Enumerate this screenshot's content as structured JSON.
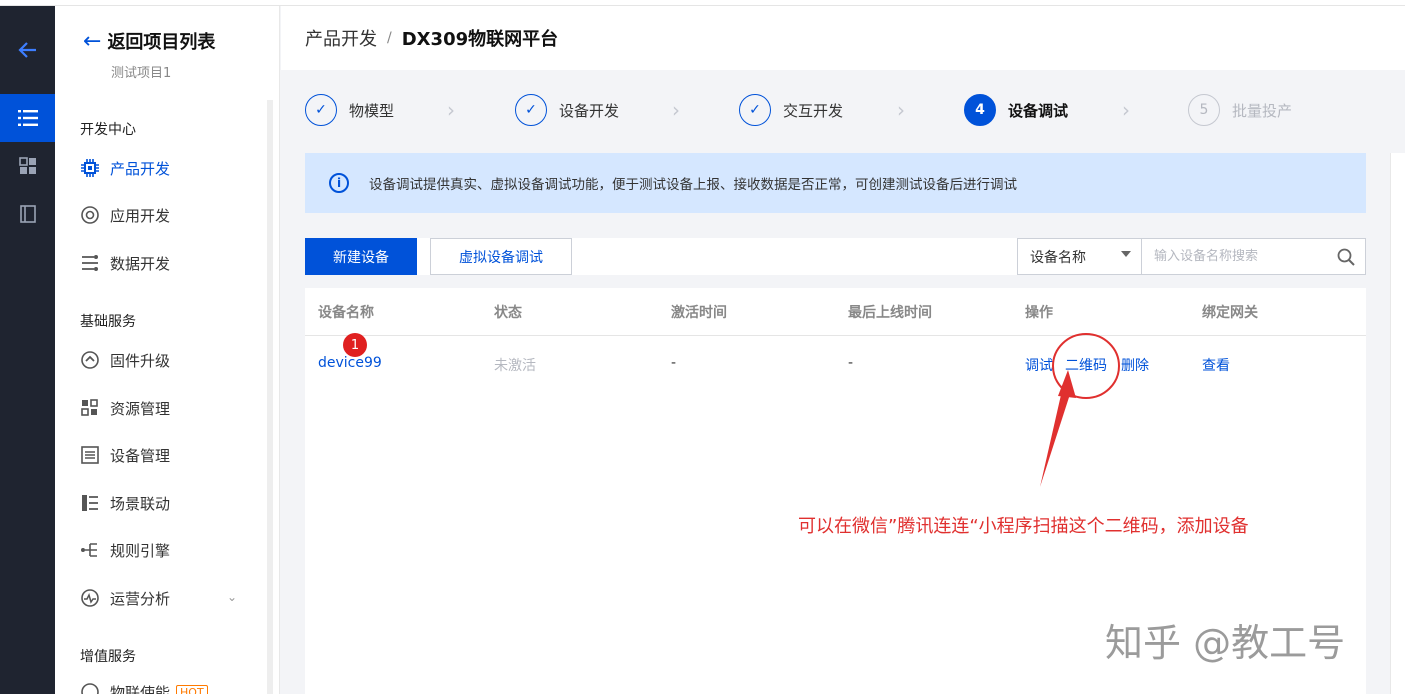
{
  "header": {
    "crumb_parent": "产品开发",
    "sep": "/",
    "crumb_current": "DX309物联网平台"
  },
  "sidebar": {
    "back_label": "返回项目列表",
    "project_name": "测试项目1",
    "sections": [
      {
        "title": "开发中心",
        "items": [
          "产品开发",
          "应用开发",
          "数据开发"
        ]
      },
      {
        "title": "基础服务",
        "items": [
          "固件升级",
          "资源管理",
          "设备管理",
          "场景联动",
          "规则引擎",
          "运营分析"
        ]
      },
      {
        "title": "增值服务",
        "items": [
          "物联使能"
        ]
      }
    ],
    "hot_badge": "HOT",
    "active_item": "产品开发"
  },
  "steps": [
    {
      "num": "✓",
      "label": "物模型",
      "state": "done"
    },
    {
      "num": "✓",
      "label": "设备开发",
      "state": "done"
    },
    {
      "num": "✓",
      "label": "交互开发",
      "state": "done"
    },
    {
      "num": "4",
      "label": "设备调试",
      "state": "current"
    },
    {
      "num": "5",
      "label": "批量投产",
      "state": "future"
    }
  ],
  "notice": {
    "text": "设备调试提供真实、虚拟设备调试功能，便于测试设备上报、接收数据是否正常，可创建测试设备后进行调试"
  },
  "toolbar": {
    "new_device": "新建设备",
    "virtual_debug": "虚拟设备调试",
    "filter_selected": "设备名称",
    "search_placeholder": "输入设备名称搜索"
  },
  "table": {
    "columns": [
      "设备名称",
      "状态",
      "激活时间",
      "最后上线时间",
      "操作",
      "绑定网关"
    ],
    "rows": [
      {
        "name": "device99",
        "status": "未激活",
        "activated": "-",
        "last_online": "-",
        "actions": [
          "调试",
          "二维码",
          "删除"
        ],
        "gateway": "查看"
      }
    ]
  },
  "annotation": {
    "badge": "1",
    "note": "可以在微信”腾讯连连“小程序扫描这个二维码，添加设备",
    "color": "#e0302f"
  },
  "watermark": "知乎 @教工号",
  "colors": {
    "primary": "#0052d9",
    "notice_bg": "#d5e7ff",
    "rail_bg": "#1f2430"
  }
}
